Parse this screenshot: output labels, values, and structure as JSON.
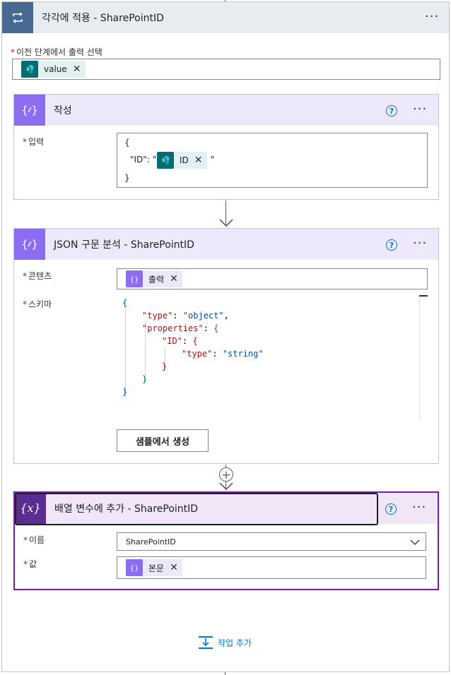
{
  "loop": {
    "title": "각각에 적용 - SharePointID",
    "field_label": "이전 단계에서 출력 선택",
    "token": "value"
  },
  "compose": {
    "title": "작성",
    "input_label": "입력",
    "line1": "{",
    "line2_prefix": "\"ID\": \"",
    "token": "ID",
    "line2_suffix": "\"",
    "line3": "}"
  },
  "parse": {
    "title": "JSON 구문 분석 - SharePointID",
    "content_label": "콘텐츠",
    "content_token": "출력",
    "schema_label": "스키마",
    "schema": {
      "l1": "{",
      "type_key": "\"type\"",
      "type_val": "\"object\"",
      "props_key": "\"properties\"",
      "id_key": "\"ID\"",
      "inner_type_key": "\"type\"",
      "inner_type_val": "\"string\"",
      "close_inner": "}",
      "close_props": "}",
      "close_root": "}"
    },
    "sample_button": "샘플에서 생성"
  },
  "append": {
    "title": "배열 변수에 추가 - SharePointID",
    "name_label": "이름",
    "name_value": "SharePointID",
    "value_label": "값",
    "value_token": "본문"
  },
  "add_action_label": "작업 추가",
  "more_glyph": "···",
  "help_glyph": "?",
  "close_glyph": "✕",
  "plus_glyph": "+",
  "required_mark": "*",
  "colors": {
    "loop_icon": "#486991",
    "compose_icon": "#8c6cf0",
    "variable_icon": "#5c2d91",
    "sharepoint": "#036c70",
    "link": "#0078d4"
  },
  "icons": {
    "loop": "loop-arrows-icon",
    "compose": "braces-icon",
    "variable": "variable-x-icon",
    "sharepoint": "sharepoint-icon",
    "add_action": "add-action-icon"
  }
}
